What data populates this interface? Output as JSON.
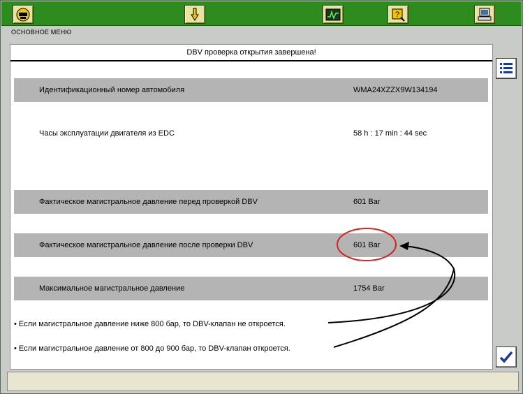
{
  "header": {
    "menu_label": "ОСНОВНОЕ МЕНЮ"
  },
  "toolbar": {
    "buttons": [
      {
        "icon": "mann-logo-icon"
      },
      {
        "icon": "hand-down-icon"
      },
      {
        "icon": "oscilloscope-icon"
      },
      {
        "icon": "help-icon"
      },
      {
        "icon": "computer-icon"
      }
    ]
  },
  "panel": {
    "title": "DBV проверка открытия завершена!",
    "rows": [
      {
        "label": "Идентификационный номер автомобиля",
        "value": "WMA24XZZX9W134194"
      },
      {
        "label": "Часы эксплуатации двигателя из EDC",
        "value": "58 h : 17 min : 44 sec"
      },
      {
        "label": "Фактическое магистральное давление перед проверкой DBV",
        "value": "601 Bar"
      },
      {
        "label": "Фактическое магистральное давление после проверки DBV",
        "value": "601 Bar"
      },
      {
        "label": "Максимальное магистральное давление",
        "value": "1754 Bar"
      }
    ],
    "notes": [
      "• Если магистральное давление ниже 800 бар, то DBV-клапан не откроется.",
      "• Если магистральное давление от 800 до 900 бар, то DBV-клапан откроется."
    ]
  },
  "sidebar": {
    "list_icon": "list-icon",
    "confirm_icon": "checkmark-icon"
  },
  "colors": {
    "toolbar": "#2e8b1e",
    "row_shade": "#b4b4b4",
    "highlight": "#d42020",
    "check": "#1a3a9a"
  }
}
